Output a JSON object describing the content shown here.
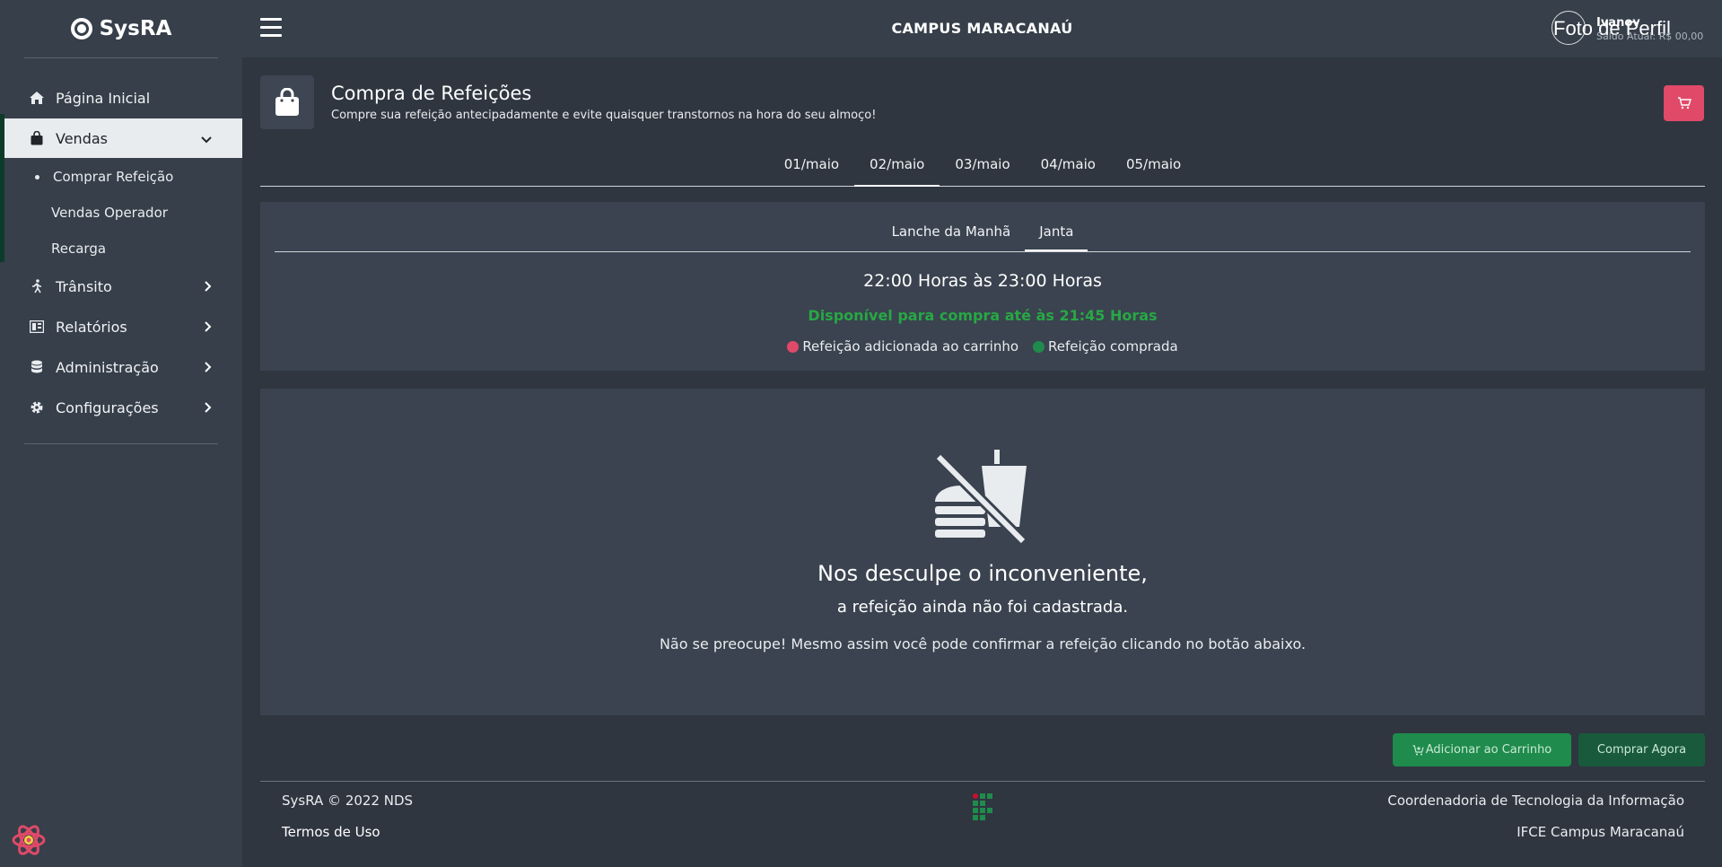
{
  "app": {
    "name": "SysRA"
  },
  "topbar": {
    "campus": "CAMPUS MARACANAÚ",
    "avatar_alt": "Foto de Perfil",
    "user_name": "Ivanov",
    "user_saldo": "Saldo Atual: R$ 00,00"
  },
  "sidebar": {
    "items": [
      {
        "label": "Página Inicial",
        "icon": "home-icon"
      },
      {
        "label": "Vendas",
        "icon": "shopping-bag-icon"
      },
      {
        "label": "Trânsito",
        "icon": "walking-icon"
      },
      {
        "label": "Relatórios",
        "icon": "report-icon"
      },
      {
        "label": "Administração",
        "icon": "database-icon"
      },
      {
        "label": "Configurações",
        "icon": "gear-icon"
      }
    ],
    "subitems": [
      {
        "label": "Comprar Refeição"
      },
      {
        "label": "Vendas Operador"
      },
      {
        "label": "Recarga"
      }
    ]
  },
  "page": {
    "title": "Compra de Refeições",
    "subtitle": "Compre sua refeição antecipadamente e evite quaisquer transtornos na hora do seu almoço!"
  },
  "day_tabs": [
    "01/maio",
    "02/maio",
    "03/maio",
    "04/maio",
    "05/maio"
  ],
  "day_tab_active": "02/maio",
  "meal": {
    "tabs": [
      "Lanche da Manhã",
      "Janta"
    ],
    "active": "Janta",
    "hours": "22:00 Horas às 23:00 Horas",
    "availability": "Disponível para compra até às 21:45 Horas",
    "legend_cart": "Refeição adicionada ao carrinho",
    "legend_bought": "Refeição comprada"
  },
  "empty": {
    "title": "Nos desculpe o inconveniente,",
    "subtitle": "a refeição ainda não foi cadastrada.",
    "note": "Não se preocupe! Mesmo assim você pode confirmar a refeição clicando no botão abaixo."
  },
  "actions": {
    "add_to_cart": "Adicionar ao Carrinho",
    "buy_now": "Comprar Agora"
  },
  "footer": {
    "copyright": "SysRA © 2022 NDS",
    "terms": "Termos de Uso",
    "coord": "Coordenadoria de Tecnologia da Informação",
    "campus": "IFCE Campus Maracanaú"
  },
  "colors": {
    "cart_red": "#e04a68",
    "available_green": "#28a745",
    "bought_green": "#1f8b4c"
  }
}
